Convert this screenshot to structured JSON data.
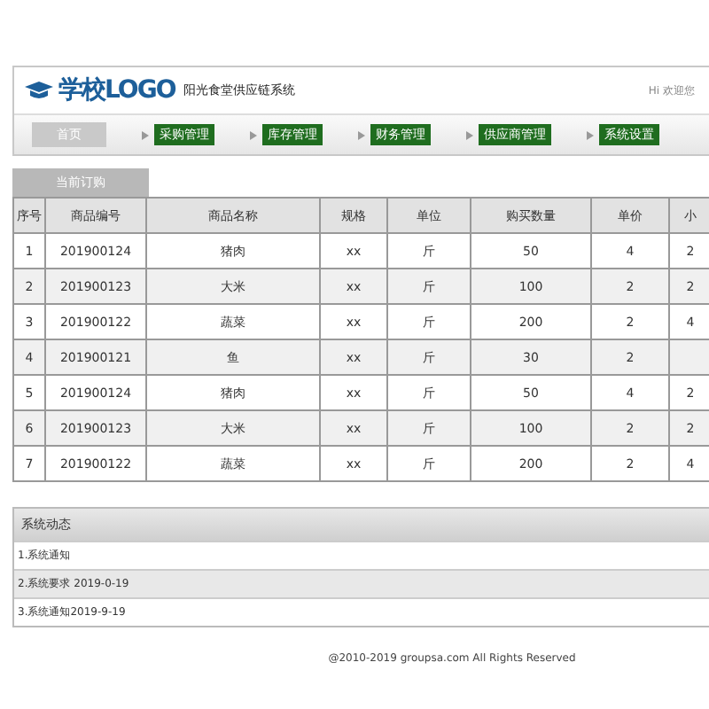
{
  "header": {
    "logo": "学校LOGO",
    "system_name": "阳光食堂供应链系统",
    "greeting": "Hi 欢迎您"
  },
  "nav": [
    {
      "label": "首页",
      "selected": true
    },
    {
      "label": "采购管理",
      "selected": false
    },
    {
      "label": "库存管理",
      "selected": false
    },
    {
      "label": "财务管理",
      "selected": false
    },
    {
      "label": "供应商管理",
      "selected": false
    },
    {
      "label": "系统设置",
      "selected": false
    }
  ],
  "order_tab": "当前订购",
  "table": {
    "columns": [
      "序号",
      "商品编号",
      "商品名称",
      "规格",
      "单位",
      "购买数量",
      "单价",
      "小"
    ],
    "rows": [
      [
        "1",
        "201900124",
        "猪肉",
        "xx",
        "斤",
        "50",
        "4",
        "2"
      ],
      [
        "2",
        "201900123",
        "大米",
        "xx",
        "斤",
        "100",
        "2",
        "2"
      ],
      [
        "3",
        "201900122",
        "蔬菜",
        "xx",
        "斤",
        "200",
        "2",
        "4"
      ],
      [
        "4",
        "201900121",
        "鱼",
        "xx",
        "斤",
        "30",
        "2",
        null
      ],
      [
        "5",
        "201900124",
        "猪肉",
        "xx",
        "斤",
        "50",
        "4",
        "2"
      ],
      [
        "6",
        "201900123",
        "大米",
        "xx",
        "斤",
        "100",
        "2",
        "2"
      ],
      [
        "7",
        "201900122",
        "蔬菜",
        "xx",
        "斤",
        "200",
        "2",
        "4"
      ]
    ]
  },
  "news": {
    "title": "系统动态",
    "items": [
      "1.系统通知",
      "2.系统要求 2019-0-19",
      "3.系统通知2019-9-19"
    ]
  },
  "footer": "@2010-2019 groupsa.com  All Rights Reserved"
}
